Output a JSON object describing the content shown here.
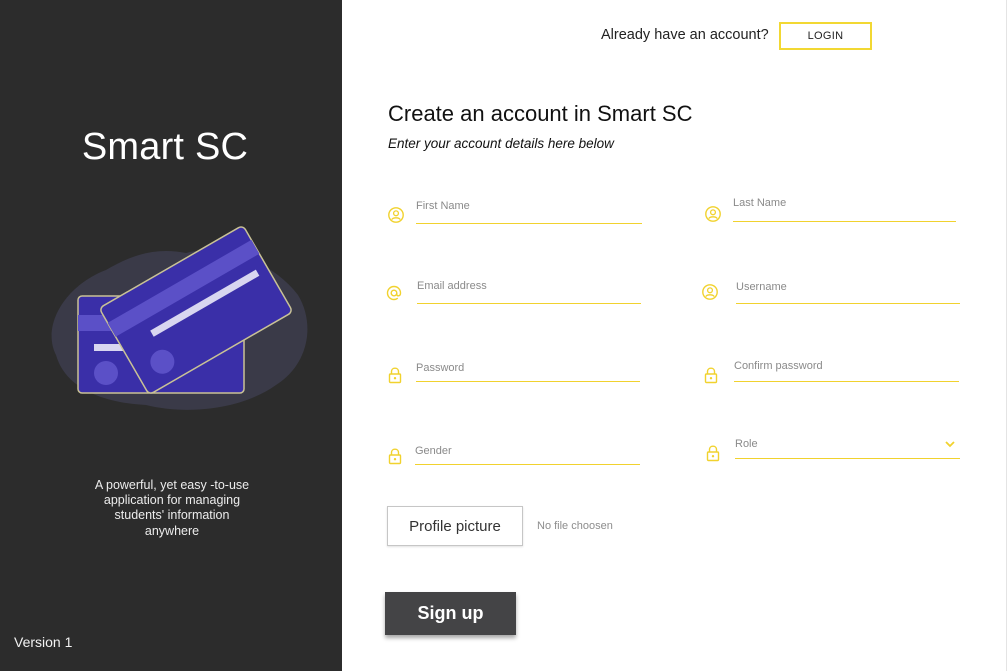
{
  "brand": {
    "name": "Smart SC",
    "tagline": "A powerful, yet easy -to-use application for managing students' information anywhere",
    "version": "Version 1"
  },
  "header": {
    "login_prompt": "Already have an account?",
    "login_button": "LOGIN"
  },
  "form": {
    "title": "Create an account in Smart SC",
    "subtitle": "Enter your account details here below",
    "fields": {
      "first_name": {
        "label": "First Name",
        "icon": "user-circle-icon"
      },
      "last_name": {
        "label": "Last Name",
        "icon": "user-circle-icon"
      },
      "email": {
        "label": "Email address",
        "icon": "at-sign-icon"
      },
      "username": {
        "label": "Username",
        "icon": "user-circle-icon"
      },
      "password": {
        "label": "Password",
        "icon": "lock-icon"
      },
      "confirm_password": {
        "label": "Confirm password",
        "icon": "lock-icon"
      },
      "gender": {
        "label": "Gender",
        "icon": "lock-icon"
      },
      "role": {
        "label": "Role",
        "icon": "lock-icon"
      }
    },
    "profile_picture_button": "Profile picture",
    "file_status": "No file choosen",
    "signup_button": "Sign up"
  },
  "colors": {
    "left_panel": "#2c2c2c",
    "accent_yellow": "#f1d22e",
    "card_blue": "#3a2fa8",
    "signup_button": "#444446"
  }
}
